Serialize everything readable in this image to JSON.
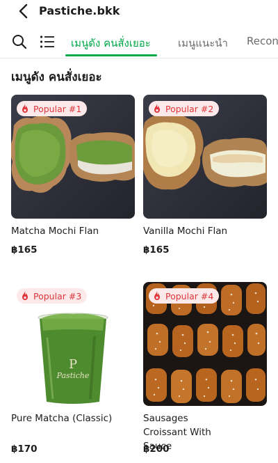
{
  "header": {
    "back_icon": "chevron-left-icon",
    "title": "Pastiche.bkk"
  },
  "tabs": {
    "search_icon": "search-icon",
    "menu_icon": "list-icon",
    "items": [
      {
        "label": "เมนูดัง คนสั่งเยอะ",
        "active": true
      },
      {
        "label": "เมนูแนะนำ",
        "active": false
      },
      {
        "label": "Recon",
        "active": false
      }
    ],
    "accent_color": "#00a846"
  },
  "section": {
    "title": "เมนูดัง คนสั่งเยอะ"
  },
  "products": [
    {
      "badge": "Popular #1",
      "name": "Matcha Mochi Flan",
      "price": "฿165"
    },
    {
      "badge": "Popular #2",
      "name": "Vanilla Mochi Flan",
      "price": "฿165"
    },
    {
      "badge": "Popular #3",
      "name": "Pure Matcha (Classic)",
      "price": "฿170",
      "cup_brand": "Pastiche"
    },
    {
      "badge": "Popular #4",
      "name": "Sausages Croissant With Sauce",
      "price": "฿200"
    }
  ],
  "badge_icon": "fire-icon",
  "badge_color": "#e0363b"
}
